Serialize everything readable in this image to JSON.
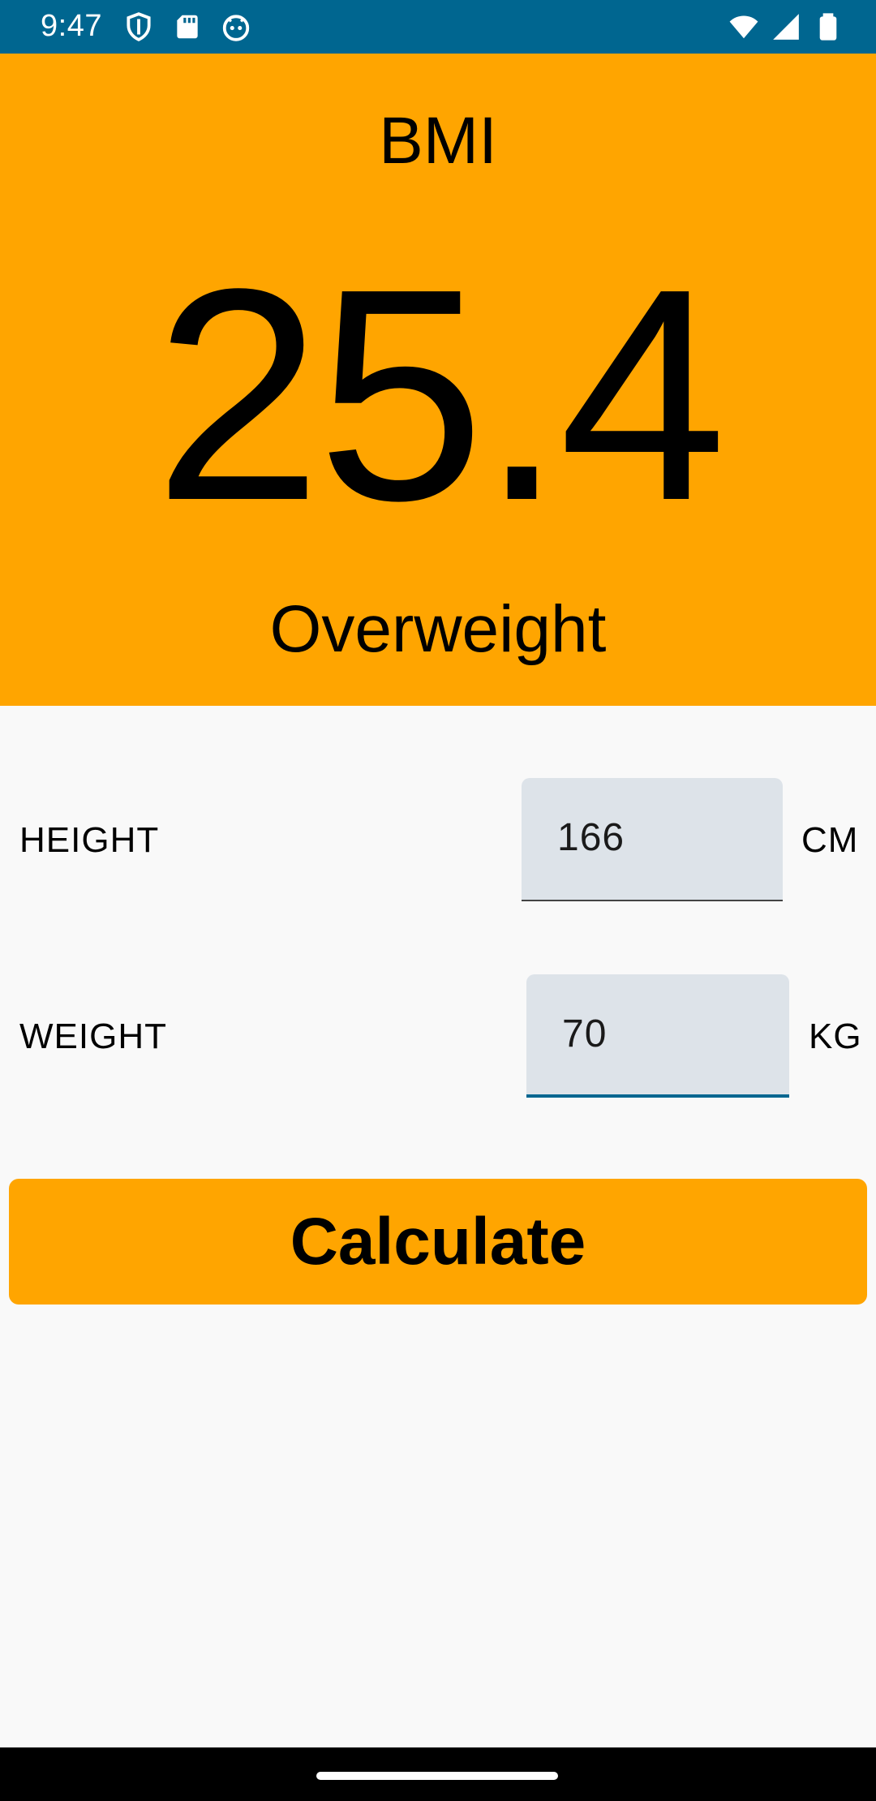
{
  "status_bar": {
    "time": "9:47",
    "left_icons": [
      "shield-icon",
      "sd-card-icon",
      "android-face-icon"
    ],
    "right_icons": [
      "wifi-icon",
      "signal-icon",
      "battery-icon"
    ],
    "background": "#006690"
  },
  "result": {
    "label": "BMI",
    "value": "25.4",
    "category": "Overweight",
    "background": "#ffa500"
  },
  "form": {
    "height": {
      "label": "HEIGHT",
      "value": "166",
      "unit": "CM"
    },
    "weight": {
      "label": "WEIGHT",
      "value": "70",
      "unit": "KG"
    }
  },
  "actions": {
    "calculate_label": "Calculate",
    "accent": "#ffa500"
  }
}
